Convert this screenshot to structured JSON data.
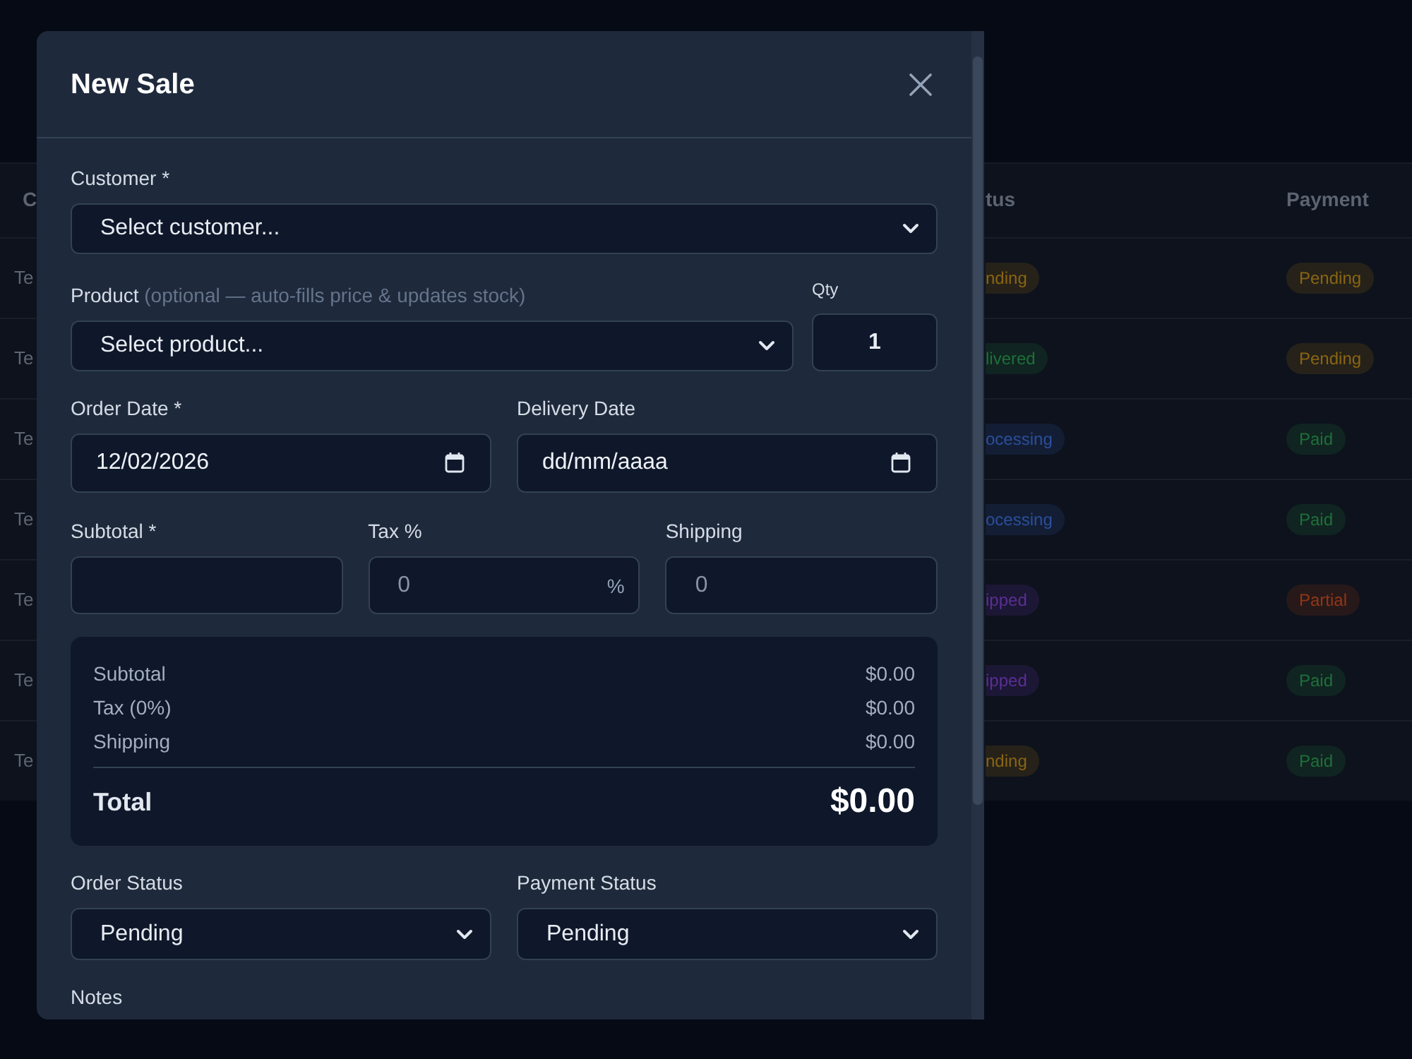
{
  "background_table": {
    "columns": [
      {
        "label": "C"
      },
      {
        "label": "tus"
      },
      {
        "label": "Payment"
      }
    ],
    "rows": [
      {
        "column_1": "Te",
        "column_2": {
          "text": "nding",
          "color": "#8a6512"
        },
        "payment": {
          "text": "Pending",
          "color": "#8a6512"
        }
      },
      {
        "column_1": "Te",
        "column_2": {
          "text": "livered",
          "color": "#1e7039"
        },
        "payment": {
          "text": "Pending",
          "color": "#8a6512"
        }
      },
      {
        "column_1": "Te",
        "column_2": {
          "text": "ocessing",
          "color": "#2b4f9c"
        },
        "payment": {
          "text": "Paid",
          "color": "#1e7039"
        }
      },
      {
        "column_1": "Te",
        "column_2": {
          "text": "ocessing",
          "color": "#2b4f9c"
        },
        "payment": {
          "text": "Paid",
          "color": "#1e7039"
        }
      },
      {
        "column_1": "Te",
        "column_2": {
          "text": "ipped",
          "color": "#5b2f96"
        },
        "payment": {
          "text": "Partial",
          "color": "#933616"
        }
      },
      {
        "column_1": "Te",
        "column_2": {
          "text": "ipped",
          "color": "#5b2f96"
        },
        "payment": {
          "text": "Paid",
          "color": "#1e7039"
        }
      },
      {
        "column_1": "Te",
        "column_2": {
          "text": "nding",
          "color": "#8a6512"
        },
        "payment": {
          "text": "Paid",
          "color": "#1e7039"
        }
      }
    ]
  },
  "dialog": {
    "title": "New Sale",
    "customer": {
      "label": "Customer *",
      "value": "Select customer..."
    },
    "product": {
      "label": "Product",
      "hint": "(optional — auto-fills price & updates stock)",
      "value": "Select product..."
    },
    "qty": {
      "label": "Qty",
      "value": "1"
    },
    "order_date": {
      "label": "Order Date *",
      "value": "12/02/2026"
    },
    "delivery_date": {
      "label": "Delivery Date",
      "placeholder": "dd/mm/aaaa"
    },
    "subtotal": {
      "label": "Subtotal *"
    },
    "tax": {
      "label": "Tax %",
      "placeholder": "0",
      "suffix": "%"
    },
    "shipping": {
      "label": "Shipping",
      "placeholder": "0"
    },
    "summary": {
      "rows": [
        {
          "label": "Subtotal",
          "value": "$0.00"
        },
        {
          "label": "Tax (0%)",
          "value": "$0.00"
        },
        {
          "label": "Shipping",
          "value": "$0.00"
        }
      ],
      "total": {
        "label": "Total",
        "value": "$0.00"
      }
    },
    "order_status": {
      "label": "Order Status",
      "value": "Pending"
    },
    "payment_status": {
      "label": "Payment Status",
      "value": "Pending"
    },
    "notes": {
      "label": "Notes"
    }
  }
}
